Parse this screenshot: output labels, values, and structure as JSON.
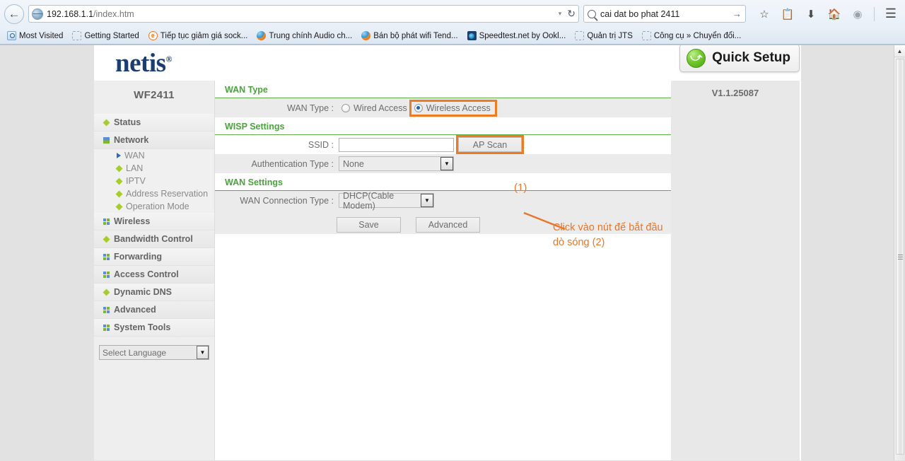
{
  "browser": {
    "back_icon": "back-arrow-icon",
    "url": "192.168.1.1",
    "url_path": "/index.htm",
    "reload_icon": "↻",
    "dropdown_icon": "▾",
    "search_value": "cai dat bo phat 2411",
    "search_go_icon": "→",
    "toolbar_icons": [
      "bookmark-star-icon",
      "reading-list-icon",
      "downloads-icon",
      "home-icon",
      "sync-icon",
      "menu-icon"
    ],
    "bookmarks": [
      {
        "label": "Most Visited",
        "icon": "most-visited-icon"
      },
      {
        "label": "Getting Started",
        "icon": "dotted-placeholder-icon"
      },
      {
        "label": "Tiếp tục giảm giá sock...",
        "icon": "orange-e-icon"
      },
      {
        "label": "Trung chính Audio ch...",
        "icon": "globe-orange-icon"
      },
      {
        "label": "Bán bộ phát wifi Tend...",
        "icon": "globe-orange-icon"
      },
      {
        "label": "Speedtest.net by Ookl...",
        "icon": "speedtest-icon"
      },
      {
        "label": "Quản trị JTS",
        "icon": "dotted-placeholder-icon"
      },
      {
        "label": "Công cụ » Chuyển đổi...",
        "icon": "dotted-placeholder-icon"
      }
    ]
  },
  "app": {
    "logo": "netis",
    "logo_mark": "®",
    "quick_setup_label": "Quick Setup",
    "quick_setup_icon": "green-refresh-icon",
    "device_name": "WF2411",
    "version": "V1.1.25087"
  },
  "sidebar": {
    "items": [
      {
        "label": "Status",
        "icon": "diamond-icon",
        "level": "top"
      },
      {
        "label": "Network",
        "icon": "bars-icon",
        "level": "top"
      },
      {
        "label": "WAN",
        "icon": "triangle-icon",
        "level": "sub",
        "active": true
      },
      {
        "label": "LAN",
        "icon": "diamond-icon",
        "level": "sub"
      },
      {
        "label": "IPTV",
        "icon": "diamond-icon",
        "level": "sub"
      },
      {
        "label": "Address Reservation",
        "icon": "diamond-icon",
        "level": "sub"
      },
      {
        "label": "Operation Mode",
        "icon": "diamond-icon",
        "level": "sub"
      },
      {
        "label": "Wireless",
        "icon": "quad-icon",
        "level": "top"
      },
      {
        "label": "Bandwidth Control",
        "icon": "diamond-icon",
        "level": "top"
      },
      {
        "label": "Forwarding",
        "icon": "quad-icon",
        "level": "top"
      },
      {
        "label": "Access Control",
        "icon": "quad-icon",
        "level": "top"
      },
      {
        "label": "Dynamic DNS",
        "icon": "diamond-icon",
        "level": "top"
      },
      {
        "label": "Advanced",
        "icon": "quad-icon",
        "level": "top"
      },
      {
        "label": "System Tools",
        "icon": "quad-icon",
        "level": "top"
      }
    ],
    "language_selector": {
      "value": "Select Language",
      "arrow_icon": "▼"
    }
  },
  "main": {
    "sections": {
      "wan_type": {
        "heading": "WAN Type",
        "row_label": "WAN Type :",
        "options": [
          {
            "label": "Wired Access",
            "checked": false
          },
          {
            "label": "Wireless Access",
            "checked": true
          }
        ]
      },
      "wisp_settings": {
        "heading": "WISP Settings",
        "ssid_label": "SSID :",
        "ssid_value": "",
        "ap_scan_label": "AP Scan",
        "auth_label": "Authentication Type :",
        "auth_value": "None",
        "auth_arrow": "▼"
      },
      "wan_settings": {
        "heading": "WAN Settings",
        "conn_label": "WAN Connection Type :",
        "conn_value": "DHCP(Cable Modem)",
        "conn_arrow": "▼",
        "save_label": "Save",
        "advanced_label": "Advanced"
      }
    }
  },
  "annotations": {
    "step1": "(1)",
    "step2_text": "Click vào nút để bắt đầu\ndò sóng  (2)",
    "color": "#e8762a"
  }
}
